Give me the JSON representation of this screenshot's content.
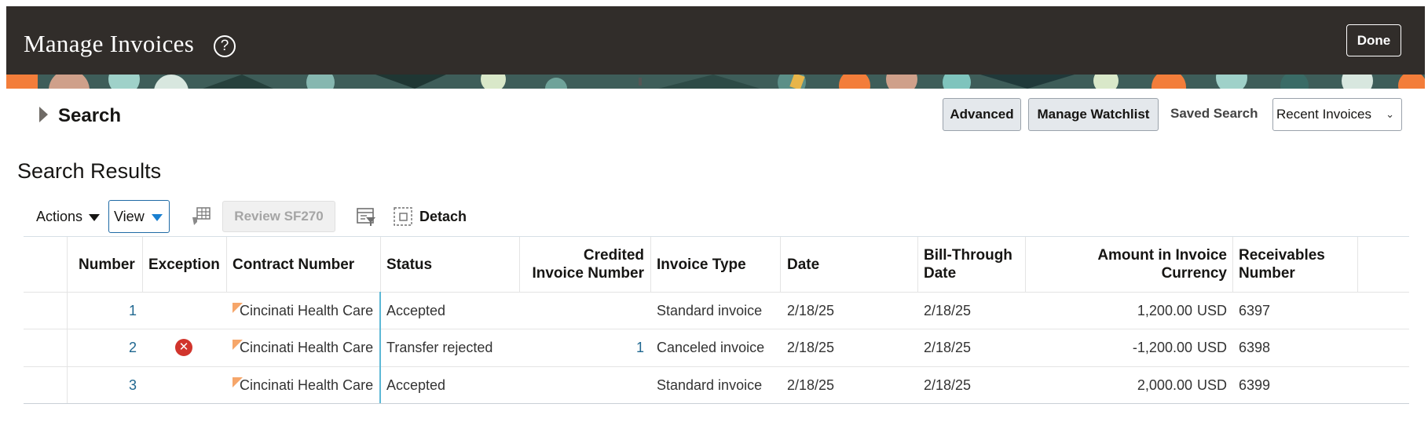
{
  "header": {
    "title": "Manage Invoices",
    "help_icon": "?",
    "done_label": "Done"
  },
  "search": {
    "label": "Search",
    "advanced_label": "Advanced",
    "watchlist_label": "Manage Watchlist",
    "saved_search_label": "Saved Search",
    "saved_search_value": "Recent Invoices"
  },
  "results": {
    "title": "Search Results",
    "toolbar": {
      "actions_label": "Actions",
      "view_label": "View",
      "review_label": "Review SF270",
      "detach_label": "Detach"
    },
    "columns": {
      "number": "Number",
      "exception": "Exception",
      "contract_number": "Contract Number",
      "status": "Status",
      "credited_invoice_number_1": "Credited",
      "credited_invoice_number_2": "Invoice Number",
      "invoice_type": "Invoice Type",
      "date": "Date",
      "bill_through_date_1": "Bill-Through",
      "bill_through_date_2": "Date",
      "amount_1": "Amount in Invoice",
      "amount_2": "Currency",
      "receivables_1": "Receivables",
      "receivables_2": "Number"
    },
    "rows": [
      {
        "number": "1",
        "exception": false,
        "contract": "Cincinati Health Care",
        "status": "Accepted",
        "credited": "",
        "invoice_type": "Standard invoice",
        "date": "2/18/25",
        "bill_through": "2/18/25",
        "amount": "1,200.00",
        "currency": "USD",
        "receivables": "6397"
      },
      {
        "number": "2",
        "exception": true,
        "contract": "Cincinati Health Care",
        "status": "Transfer rejected",
        "credited": "1",
        "invoice_type": "Canceled invoice",
        "date": "2/18/25",
        "bill_through": "2/18/25",
        "amount": "-1,200.00",
        "currency": "USD",
        "receivables": "6398"
      },
      {
        "number": "3",
        "exception": false,
        "contract": "Cincinati Health Care",
        "status": "Accepted",
        "credited": "",
        "invoice_type": "Standard invoice",
        "date": "2/18/25",
        "bill_through": "2/18/25",
        "amount": "2,000.00",
        "currency": "USD",
        "receivables": "6399"
      }
    ]
  },
  "icons": {
    "help": "help-circle-icon",
    "search_toggle": "disclosure-triangle-icon",
    "freeze": "freeze-columns-icon",
    "query_by_example": "query-by-example-icon",
    "detach": "detach-icon",
    "exception": "error-circle-icon",
    "contract_flag": "corner-flag-icon"
  },
  "colors": {
    "header_bg": "#312d2a",
    "link": "#1f6790",
    "error": "#d1342c",
    "freeze_line": "#5db8d6",
    "flag": "#f6a66a"
  }
}
